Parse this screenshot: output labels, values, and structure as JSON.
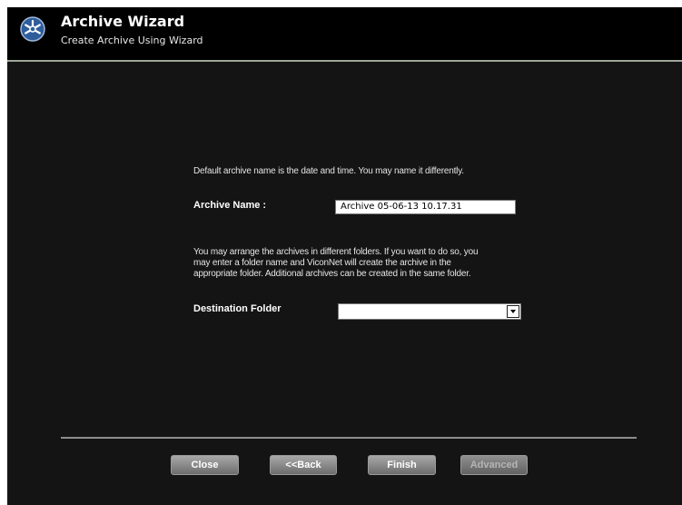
{
  "header": {
    "title": "Archive Wizard",
    "subtitle": "Create Archive Using Wizard"
  },
  "form": {
    "intro_text": "Default archive name is the date and time. You may name it differently.",
    "archive_name_label": "Archive Name :",
    "archive_name_value": "Archive 05-06-13 10.17.31",
    "folder_help_line1": "You may arrange the archives in different folders. If you want to do so, you",
    "folder_help_line2": "may enter a folder name and ViconNet will create the archive in the",
    "folder_help_line3": "appropriate folder. Additional archives can be created in the same folder.",
    "destination_label": "Destination Folder",
    "destination_value": ""
  },
  "buttons": {
    "close": "Close",
    "back": "<<Back",
    "finish": "Finish",
    "advanced": "Advanced"
  },
  "colors": {
    "background": "#141414",
    "header": "#000000",
    "logo": "#2e5d9c"
  }
}
